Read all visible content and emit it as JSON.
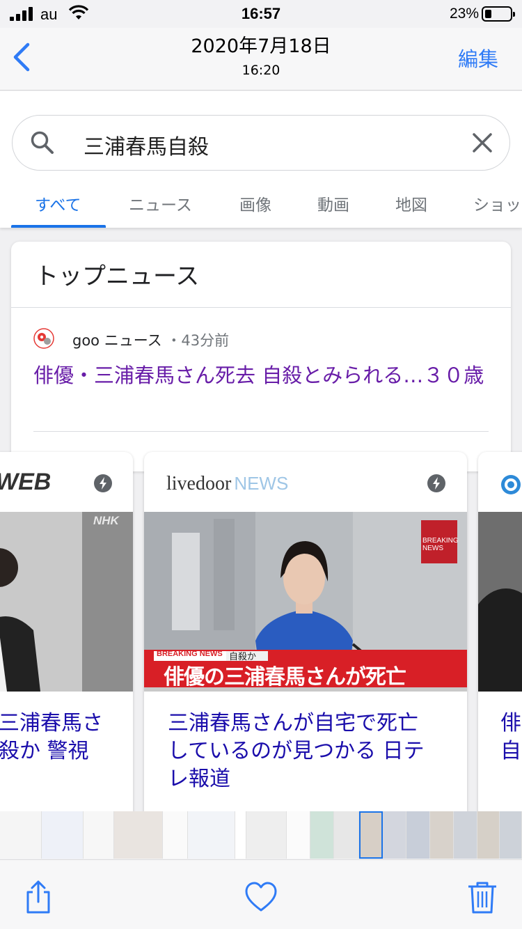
{
  "status_bar": {
    "carrier": "au",
    "time": "16:57",
    "battery_percent": "23%",
    "battery_level": 0.23
  },
  "photos_nav": {
    "back_icon": "chevron-left-icon",
    "date": "2020年7月18日",
    "time": "16:20",
    "edit_label": "編集"
  },
  "google": {
    "search": {
      "query": "三浦春馬自殺",
      "search_icon": "search-icon",
      "clear_icon": "close-icon"
    },
    "tabs": [
      {
        "label": "すべて",
        "active": true
      },
      {
        "label": "ニュース"
      },
      {
        "label": "画像"
      },
      {
        "label": "動画"
      },
      {
        "label": "地図"
      },
      {
        "label": "ショッ"
      }
    ],
    "top_news": {
      "title": "トップニュース",
      "item": {
        "source": "goo ニュース",
        "age": "・43分前",
        "headline": "俳優・三浦春馬さん死去 自殺とみられる…３０歳"
      }
    },
    "carousel": [
      {
        "logo_text": "WEB",
        "headline_lines": [
          "三浦春馬さ",
          "殺か 警視"
        ],
        "image_text": "NHK"
      },
      {
        "logo_text": "livedoor",
        "logo_text_2": "NEWS",
        "headline_lines": [
          "三浦春馬さんが自宅で死亡",
          "しているのが見つかる 日テ",
          "レ報道"
        ],
        "image_text": {
          "banner_small": "BREAKING NEWS",
          "banner_small_2": "自殺か",
          "banner_main": "俳優の三浦春馬さんが死亡",
          "corner_label": "BREAKING NEWS"
        }
      },
      {
        "headline_lines": [
          "俳",
          "自"
        ]
      }
    ]
  },
  "toolbar": {
    "share_icon": "share-icon",
    "favorite_icon": "heart-icon",
    "trash_icon": "trash-icon"
  },
  "colors": {
    "ios_blue": "#2f7bf6",
    "google_blue": "#1a73e8",
    "visited_link": "#681da8",
    "link": "#1a0dab",
    "breaking_red": "#d81f26"
  }
}
